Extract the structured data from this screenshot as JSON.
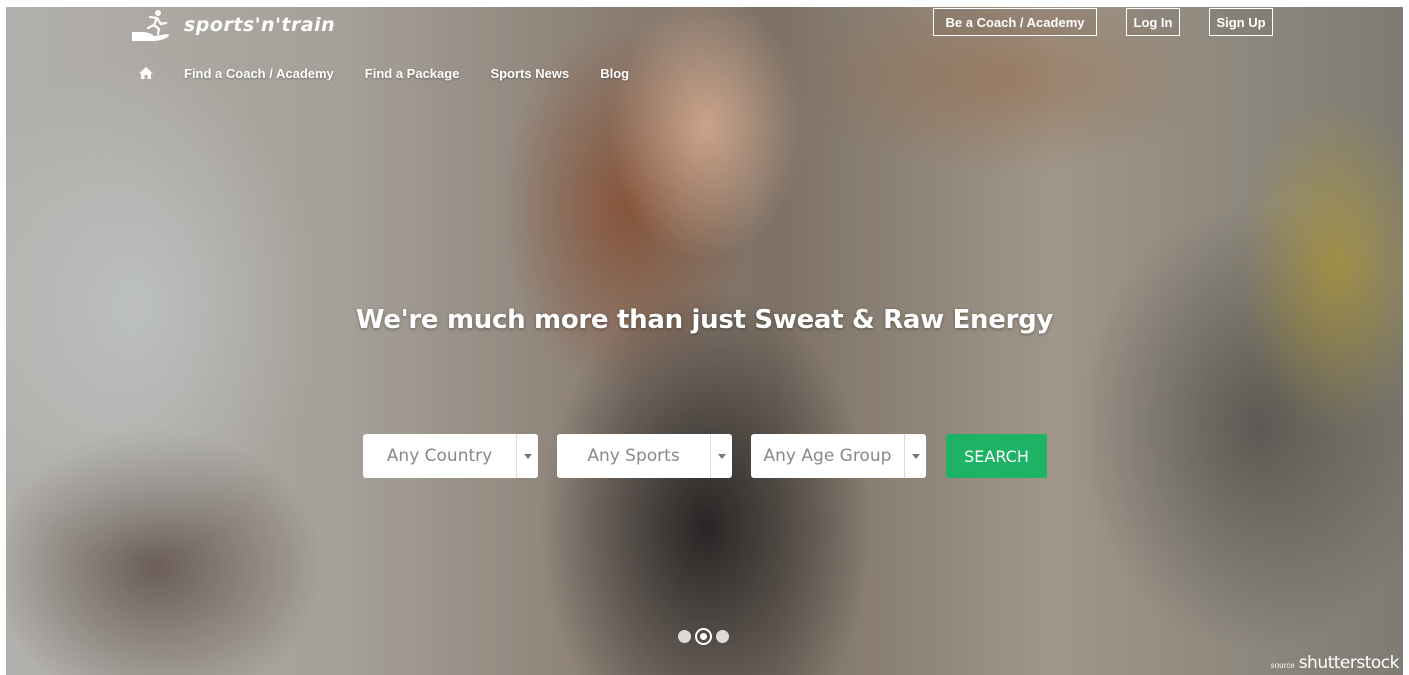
{
  "brand": {
    "name": "sports'n'train",
    "logo_icon": "running-person-hand-icon"
  },
  "header": {
    "buttons": {
      "coach": "Be a Coach / Academy",
      "login": "Log In",
      "signup": "Sign Up"
    }
  },
  "nav": {
    "home_icon": "home-icon",
    "items": [
      {
        "label": "Find a Coach / Academy"
      },
      {
        "label": "Find a Package"
      },
      {
        "label": "Sports News"
      },
      {
        "label": "Blog"
      }
    ]
  },
  "hero": {
    "headline": "We're much more than just Sweat & Raw Energy"
  },
  "search": {
    "country": {
      "value": "Any Country"
    },
    "sports": {
      "value": "Any Sports"
    },
    "age_group": {
      "value": "Any Age Group"
    },
    "button_label": "SEARCH",
    "button_color": "#1db264"
  },
  "carousel": {
    "slides": 3,
    "active_index": 2
  },
  "credit": {
    "source_label": "source",
    "brand": "shutterstock"
  }
}
